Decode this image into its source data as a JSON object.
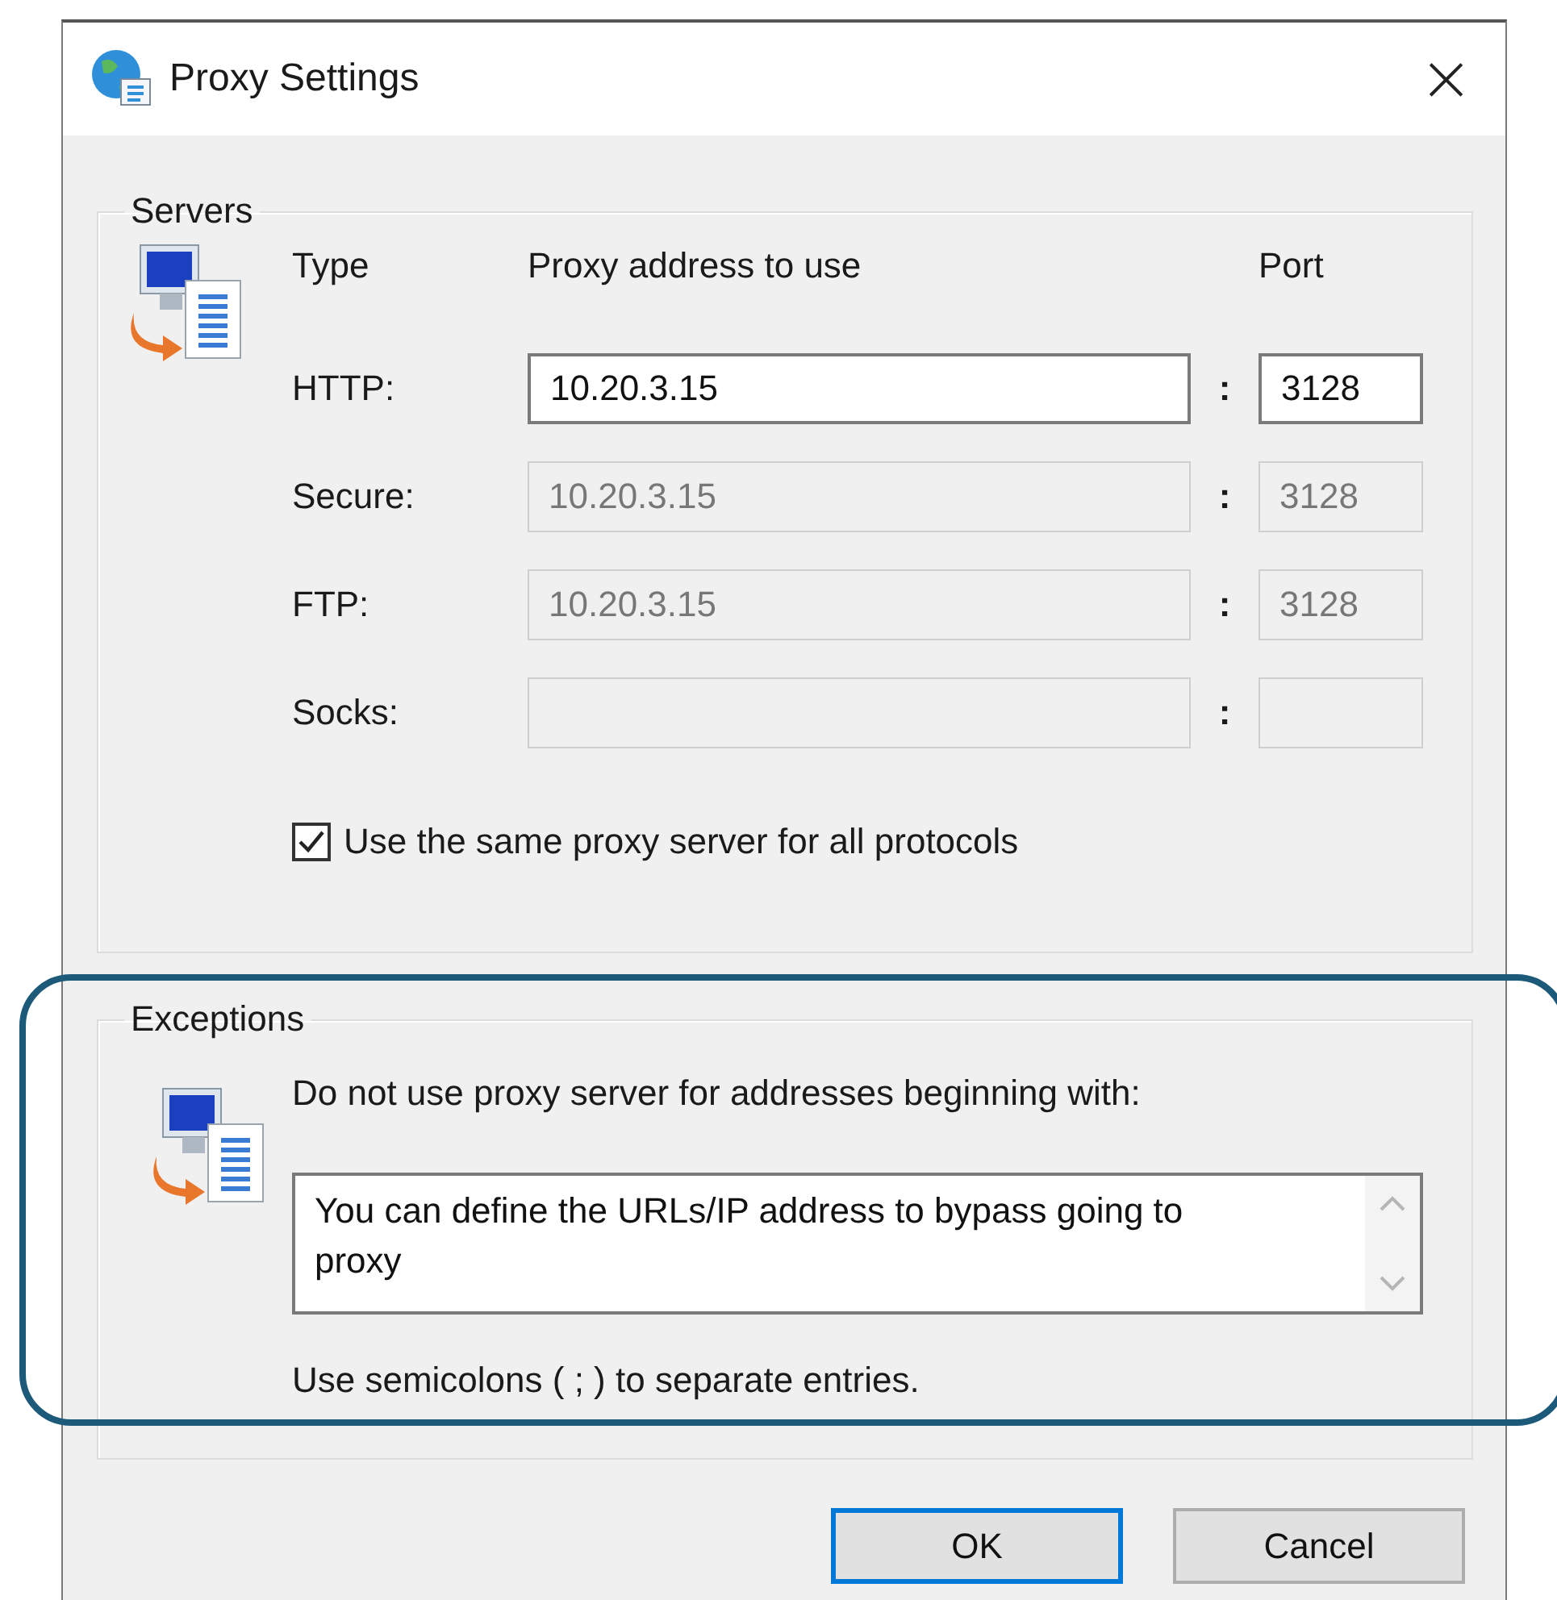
{
  "window": {
    "title": "Proxy Settings",
    "close": "×"
  },
  "servers": {
    "legend": "Servers",
    "headers": {
      "type": "Type",
      "address": "Proxy address to use",
      "port": "Port"
    },
    "rows": [
      {
        "type": "HTTP:",
        "address": "10.20.3.15",
        "separator": ":",
        "port": "3128",
        "disabled": false
      },
      {
        "type": "Secure:",
        "address": "10.20.3.15",
        "separator": ":",
        "port": "3128",
        "disabled": true
      },
      {
        "type": "FTP:",
        "address": "10.20.3.15",
        "separator": ":",
        "port": "3128",
        "disabled": true
      },
      {
        "type": "Socks:",
        "separator": ":",
        "disabled": true
      }
    ],
    "same_for_all": {
      "label": "Use the same proxy server for all protocols",
      "checked": true
    }
  },
  "exceptions": {
    "legend": "Exceptions",
    "highlighted": true,
    "instruction": "Do not use proxy server for addresses beginning with:",
    "value": "You can define the URLs/IP address to bypass going to proxy",
    "hint": "Use semicolons ( ; ) to separate entries."
  },
  "buttons": [
    {
      "label": "OK",
      "default": true
    },
    {
      "label": "Cancel",
      "default": false
    }
  ]
}
